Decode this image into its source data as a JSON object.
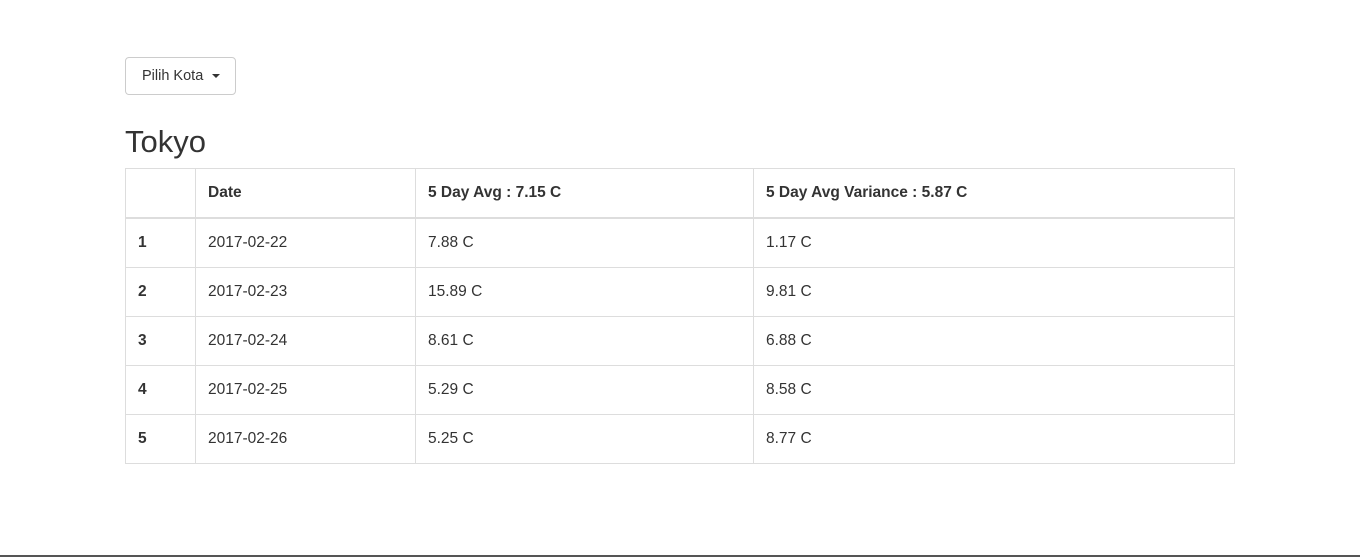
{
  "dropdown": {
    "label": "Pilih Kota"
  },
  "city": {
    "name": "Tokyo"
  },
  "table": {
    "headers": [
      "",
      "Date",
      "5 Day Avg : 7.15 C",
      "5 Day Avg Variance : 5.87 C"
    ],
    "rows": [
      {
        "index": "1",
        "date": "2017-02-22",
        "temp": "7.88 C",
        "variance": "1.17 C"
      },
      {
        "index": "2",
        "date": "2017-02-23",
        "temp": "15.89 C",
        "variance": "9.81 C"
      },
      {
        "index": "3",
        "date": "2017-02-24",
        "temp": "8.61 C",
        "variance": "6.88 C"
      },
      {
        "index": "4",
        "date": "2017-02-25",
        "temp": "5.29 C",
        "variance": "8.58 C"
      },
      {
        "index": "5",
        "date": "2017-02-26",
        "temp": "5.25 C",
        "variance": "8.77 C"
      }
    ]
  }
}
